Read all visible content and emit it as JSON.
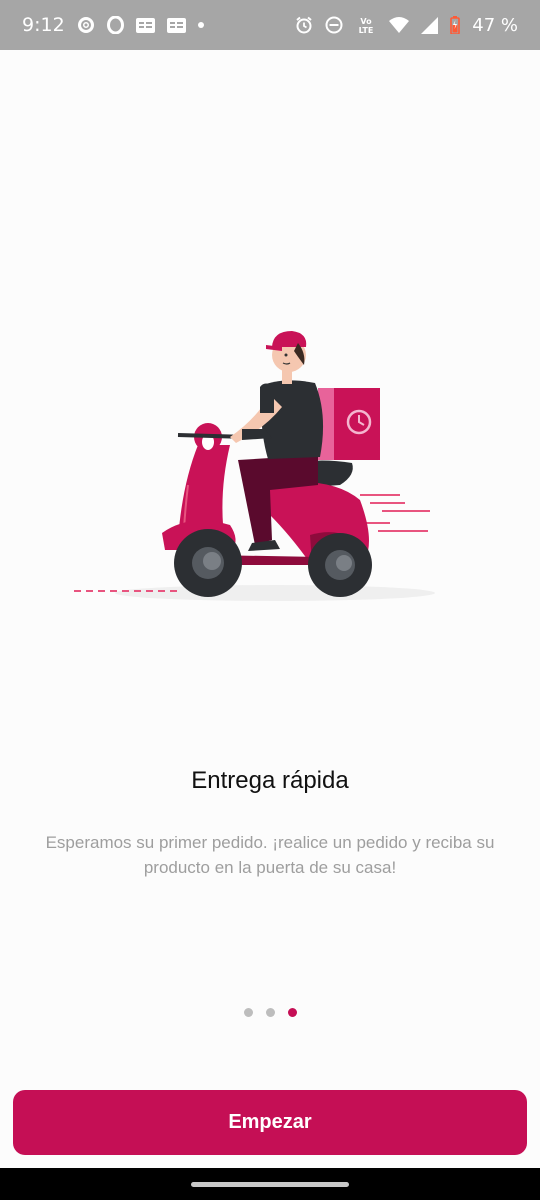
{
  "status_bar": {
    "time": "9:12",
    "battery": "47 %",
    "icons": [
      "settings-app-icon",
      "opera-icon",
      "ge-icon",
      "ge-icon",
      "dot-icon",
      "alarm-icon",
      "dnd-icon",
      "volte-icon",
      "wifi-icon",
      "signal-icon",
      "battery-icon"
    ],
    "volte_text": "Vo LTE"
  },
  "onboarding": {
    "illustration": "delivery-scooter-illustration",
    "title": "Entrega rápida",
    "description": "Esperamos su primer pedido. ¡realice un pedido y reciba su producto en la puerta de su casa!",
    "pages": 3,
    "active_page": 3
  },
  "cta": {
    "label": "Empezar"
  },
  "colors": {
    "accent": "#c50f55",
    "status_bar": "#a6a6a6",
    "background": "#fcfcfc",
    "dot_inactive": "#bdbdbd"
  }
}
